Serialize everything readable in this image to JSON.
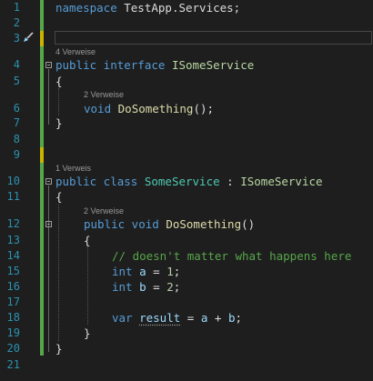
{
  "editor": {
    "line_numbers": [
      "1",
      "2",
      "3",
      "4",
      "5",
      "6",
      "7",
      "8",
      "9",
      "10",
      "11",
      "12",
      "13",
      "14",
      "15",
      "16",
      "17",
      "18",
      "19",
      "20",
      "21"
    ],
    "references": {
      "interface_refs": "4 Verweise",
      "method_refs_1": "2 Verweise",
      "class_refs": "1 Verweis",
      "method_refs_2": "2 Verweise"
    },
    "code": {
      "l1": {
        "kw": "namespace",
        "name": " TestApp.Services;"
      },
      "l4": {
        "kw": "public interface ",
        "name": "ISomeService"
      },
      "l5": "{",
      "l6": {
        "kw": "void ",
        "name": "DoSomething",
        "rest": "();"
      },
      "l7": "}",
      "l10": {
        "kw": "public class ",
        "name": "SomeService",
        "sep": " : ",
        "base": "ISomeService"
      },
      "l11": "{",
      "l12": {
        "kw": "public void ",
        "name": "DoSomething",
        "rest": "()"
      },
      "l13": "{",
      "l14": "// doesn't matter what happens here",
      "l15": {
        "kw": "int ",
        "var": "a",
        "op": " = ",
        "num": "1",
        "end": ";"
      },
      "l16": {
        "kw": "int ",
        "var": "b",
        "op": " = ",
        "num": "2",
        "end": ";"
      },
      "l18": {
        "kw": "var ",
        "var": "result",
        "op": " = ",
        "a": "a",
        "plus": " + ",
        "b": "b",
        "end": ";"
      },
      "l19": "}",
      "l20": "}"
    },
    "colors": {
      "background": "#1e1e1e",
      "line_number": "#2b91af",
      "keyword": "#569cd6",
      "interface": "#b8d7a3",
      "class": "#4ec9b0",
      "method": "#dcdcaa",
      "comment": "#57a64a",
      "variable": "#9cdcfe",
      "number": "#b5cea8",
      "change_saved": "#57a64a",
      "change_unsaved": "#c8b400"
    },
    "icons": [
      "fold-toggle-icon",
      "quick-actions-brush-icon"
    ]
  }
}
